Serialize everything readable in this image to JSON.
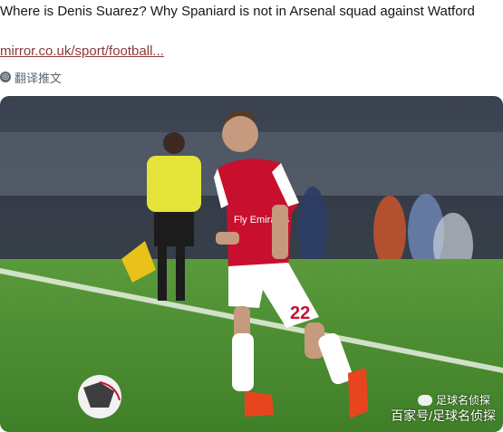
{
  "tweet": {
    "text": "Where is Denis Suarez? Why Spaniard is not in Arsenal squad against Watford",
    "link": "mirror.co.uk/sport/football...",
    "translate_label": "翻译推文",
    "translate_icon": "globe-icon"
  },
  "photo": {
    "shirt_sponsor": "Fly Emirates",
    "shorts_number": "22",
    "watermark_top": "足球名侦探",
    "watermark_bottom": "百家号/足球名侦探"
  },
  "colors": {
    "link": "#8b3a3a",
    "arsenal_red": "#c8102e",
    "pitch_green": "#3f8a2e",
    "referee_yellow": "#f2e33a"
  }
}
